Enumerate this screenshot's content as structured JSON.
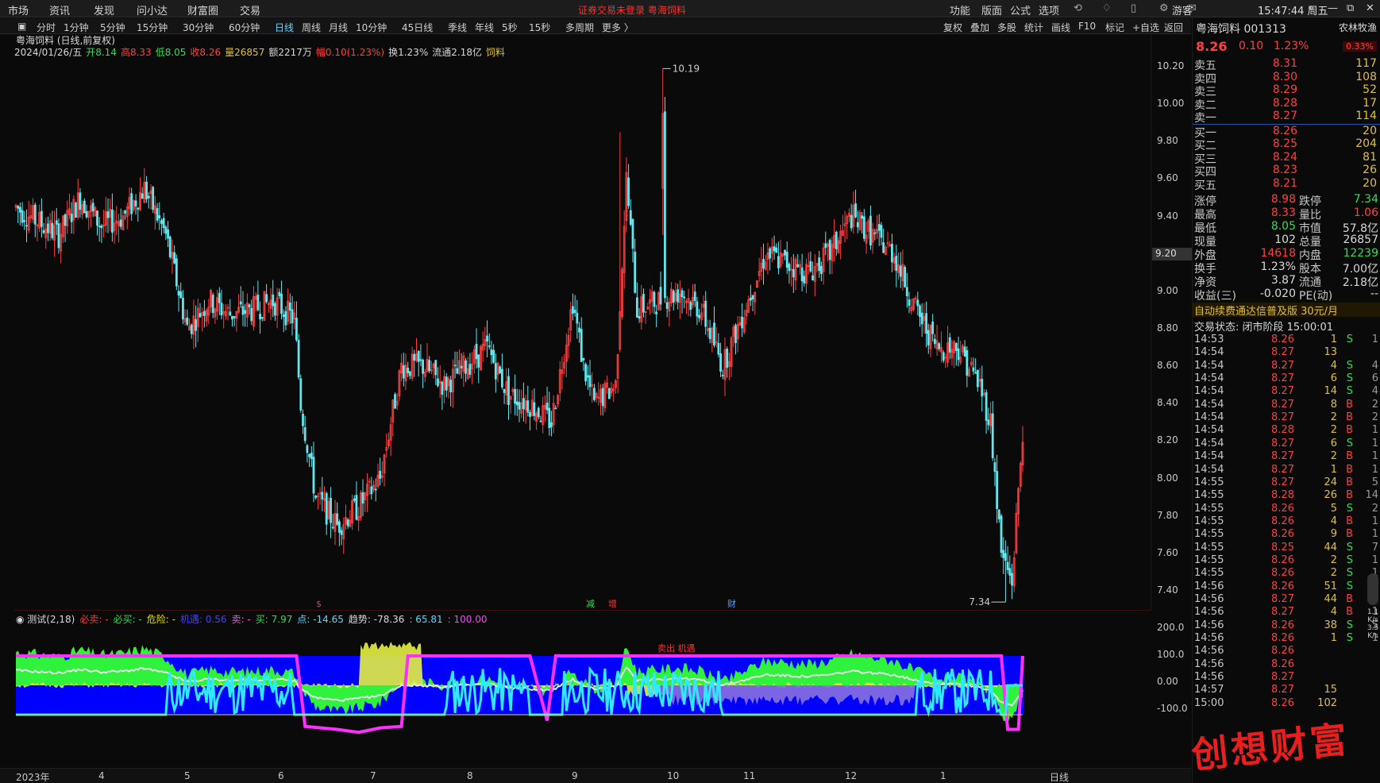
{
  "topbar": {
    "menus": [
      "市场",
      "资讯",
      "发现",
      "问小达",
      "财富圈",
      "交易"
    ],
    "notice": "证券交易未登录  粤海饲料",
    "right": [
      "功能",
      "版面",
      "公式",
      "选项"
    ],
    "guest": "游客",
    "clock": "15:47:44 周五"
  },
  "periods": [
    "分时",
    "1分钟",
    "5分钟",
    "15分钟",
    "30分钟",
    "60分钟",
    "日线",
    "周线",
    "月线",
    "10分钟",
    "45日线",
    "季线",
    "年线",
    "5秒",
    "15秒",
    "多周期",
    "更多 〉"
  ],
  "active_period": "日线",
  "tools": [
    "复权",
    "叠加",
    "多股",
    "统计",
    "画线",
    "F10",
    "标记",
    "+自选",
    "返回"
  ],
  "chart": {
    "title": "粤海饲料 (日线,前复权)",
    "info": [
      {
        "t": "2024/01/26/五",
        "c": "#d8d8d8"
      },
      {
        "t": "开8.14",
        "c": "#33dd55"
      },
      {
        "t": "高8.33",
        "c": "#ff4040"
      },
      {
        "t": "低8.05",
        "c": "#33dd55"
      },
      {
        "t": "收8.26",
        "c": "#ff4040"
      },
      {
        "t": "量26857",
        "c": "#e0c040"
      },
      {
        "t": "额2217万",
        "c": "#d8d8d8"
      },
      {
        "t": "幅0.10(1.23%)",
        "c": "#ff4040"
      },
      {
        "t": "换1.23%",
        "c": "#d8d8d8"
      },
      {
        "t": "流通2.18亿",
        "c": "#d8d8d8"
      },
      {
        "t": "饲料",
        "c": "#e0c040"
      }
    ],
    "high_label": "10.19",
    "low_label": "7.34",
    "cursor_price": "9.20",
    "yticks": [
      "10.20",
      "10.00",
      "9.80",
      "9.60",
      "9.40",
      "9.20",
      "9.00",
      "8.80",
      "8.60",
      "8.40",
      "8.20",
      "8.00",
      "7.80",
      "7.60",
      "7.40"
    ],
    "ind_yticks": [
      "200.0",
      "100.0",
      "0.00",
      "-100.0"
    ],
    "xlabels": [
      "2023年",
      "4",
      "5",
      "6",
      "7",
      "8",
      "9",
      "10",
      "11",
      "12",
      "1"
    ],
    "xaxis_right": "日线",
    "events": [
      {
        "t": "$",
        "c": "#ff3030"
      },
      {
        "t": "减",
        "c": "#33dd55"
      },
      {
        "t": "增",
        "c": "#ff3030"
      },
      {
        "t": "财",
        "c": "#5fa0ff"
      }
    ]
  },
  "indicator": {
    "title": "测试(2,18)",
    "fields": [
      {
        "t": "必卖: -",
        "c": "#ff3030"
      },
      {
        "t": "必买: -",
        "c": "#33dd55"
      },
      {
        "t": "危险: -",
        "c": "#e0e000"
      },
      {
        "t": "机遇: 0.56",
        "c": "#4040ff"
      },
      {
        "t": "卖: -",
        "c": "#ff40ff"
      },
      {
        "t": "买: 7.97",
        "c": "#33dd55"
      },
      {
        "t": "点: -14.65",
        "c": "#5fd7ff"
      },
      {
        "t": "趋势: -78.36",
        "c": "#d8d8d8"
      },
      {
        "t": ": 65.81",
        "c": "#5fd7ff"
      },
      {
        "t": ": 100.00",
        "c": "#ff40ff"
      }
    ],
    "mid_text": "卖出 机遇"
  },
  "side": {
    "name": "粤海饲料 001313",
    "tag": "农林牧渔",
    "price": "8.26",
    "chg": "0.10",
    "pct": "1.23%",
    "pct_box": "0.33%",
    "asks": [
      {
        "l": "卖五",
        "p": "8.31",
        "v": "117"
      },
      {
        "l": "卖四",
        "p": "8.30",
        "v": "108"
      },
      {
        "l": "卖三",
        "p": "8.29",
        "v": "52"
      },
      {
        "l": "卖二",
        "p": "8.28",
        "v": "17"
      },
      {
        "l": "卖一",
        "p": "8.27",
        "v": "114"
      }
    ],
    "bids": [
      {
        "l": "买一",
        "p": "8.26",
        "v": "20"
      },
      {
        "l": "买二",
        "p": "8.25",
        "v": "204"
      },
      {
        "l": "买三",
        "p": "8.24",
        "v": "81"
      },
      {
        "l": "买四",
        "p": "8.23",
        "v": "26"
      },
      {
        "l": "买五",
        "p": "8.21",
        "v": "20"
      }
    ],
    "stats": [
      [
        {
          "t": "涨停",
          "c": "#c8c8c8"
        },
        {
          "t": "8.98",
          "c": "#ff4040"
        },
        {
          "t": "跌停",
          "c": "#c8c8c8"
        },
        {
          "t": "7.34",
          "c": "#33dd55"
        }
      ],
      [
        {
          "t": "最高",
          "c": "#c8c8c8"
        },
        {
          "t": "8.33",
          "c": "#ff4040"
        },
        {
          "t": "量比",
          "c": "#c8c8c8"
        },
        {
          "t": "1.06",
          "c": "#ff4040"
        }
      ],
      [
        {
          "t": "最低",
          "c": "#c8c8c8"
        },
        {
          "t": "8.05",
          "c": "#33dd55"
        },
        {
          "t": "市值",
          "c": "#c8c8c8"
        },
        {
          "t": "57.8亿",
          "c": "#d8d8d8"
        }
      ],
      [
        {
          "t": "现量",
          "c": "#c8c8c8"
        },
        {
          "t": "102",
          "c": "#d8d8d8"
        },
        {
          "t": "总量",
          "c": "#c8c8c8"
        },
        {
          "t": "26857",
          "c": "#d8d8d8"
        }
      ],
      [
        {
          "t": "外盘",
          "c": "#c8c8c8"
        },
        {
          "t": "14618",
          "c": "#ff4040"
        },
        {
          "t": "内盘",
          "c": "#c8c8c8"
        },
        {
          "t": "12239",
          "c": "#33dd55"
        }
      ],
      [
        {
          "t": "换手",
          "c": "#c8c8c8"
        },
        {
          "t": "1.23%",
          "c": "#d8d8d8"
        },
        {
          "t": "股本",
          "c": "#c8c8c8"
        },
        {
          "t": "7.00亿",
          "c": "#d8d8d8"
        }
      ],
      [
        {
          "t": "净资",
          "c": "#c8c8c8"
        },
        {
          "t": "3.87",
          "c": "#d8d8d8"
        },
        {
          "t": "流通",
          "c": "#c8c8c8"
        },
        {
          "t": "2.18亿",
          "c": "#d8d8d8"
        }
      ],
      [
        {
          "t": "收益(三)",
          "c": "#c8c8c8"
        },
        {
          "t": "-0.020",
          "c": "#d8d8d8"
        },
        {
          "t": "PE(动)",
          "c": "#c8c8c8"
        },
        {
          "t": "--",
          "c": "#d8d8d8"
        }
      ]
    ],
    "promo": "自动续费通达信普及版  30元/月",
    "status": "交易状态: 闭市阶段 15:00:01",
    "ticks": [
      [
        "14:53",
        "8.26",
        "1",
        "S",
        "1"
      ],
      [
        "14:54",
        "8.27",
        "13",
        "",
        ""
      ],
      [
        "14:54",
        "8.27",
        "4",
        "S",
        "4"
      ],
      [
        "14:54",
        "8.27",
        "6",
        "S",
        "6"
      ],
      [
        "14:54",
        "8.27",
        "14",
        "S",
        "4"
      ],
      [
        "14:54",
        "8.27",
        "8",
        "B",
        "2"
      ],
      [
        "14:54",
        "8.27",
        "2",
        "B",
        "2"
      ],
      [
        "14:54",
        "8.28",
        "2",
        "B",
        "1"
      ],
      [
        "14:54",
        "8.27",
        "6",
        "S",
        "1"
      ],
      [
        "14:54",
        "8.27",
        "2",
        "B",
        "1"
      ],
      [
        "14:54",
        "8.27",
        "1",
        "B",
        "1"
      ],
      [
        "14:55",
        "8.27",
        "24",
        "B",
        "5"
      ],
      [
        "14:55",
        "8.28",
        "26",
        "B",
        "14"
      ],
      [
        "14:55",
        "8.26",
        "5",
        "S",
        "2"
      ],
      [
        "14:55",
        "8.26",
        "4",
        "B",
        "1"
      ],
      [
        "14:55",
        "8.26",
        "9",
        "B",
        "1"
      ],
      [
        "14:55",
        "8.25",
        "44",
        "S",
        "7"
      ],
      [
        "14:55",
        "8.26",
        "2",
        "S",
        "1"
      ],
      [
        "14:55",
        "8.26",
        "2",
        "S",
        "1"
      ],
      [
        "14:56",
        "8.26",
        "51",
        "S",
        "1"
      ],
      [
        "14:56",
        "8.27",
        "44",
        "B",
        "2"
      ],
      [
        "14:56",
        "8.27",
        "4",
        "B",
        "1"
      ],
      [
        "14:56",
        "8.26",
        "38",
        "S",
        "5"
      ],
      [
        "14:56",
        "8.26",
        "1",
        "S",
        "1"
      ],
      [
        "14:56",
        "8.26",
        "",
        "",
        ""
      ],
      [
        "14:56",
        "8.26",
        "",
        "",
        ""
      ],
      [
        "14:56",
        "8.27",
        "",
        "",
        ""
      ],
      [
        "14:57",
        "8.27",
        "15",
        "",
        ""
      ],
      [
        "15:00",
        "8.26",
        "102",
        "",
        ""
      ]
    ],
    "speed": [
      "1.1",
      "K/s",
      "3.5",
      "K/s"
    ]
  },
  "watermark": "创想财富",
  "colors": {
    "up": "#ff4040",
    "down": "#5fe8f0",
    "bg": "#0a0a0a",
    "grid": "#3a1010"
  }
}
